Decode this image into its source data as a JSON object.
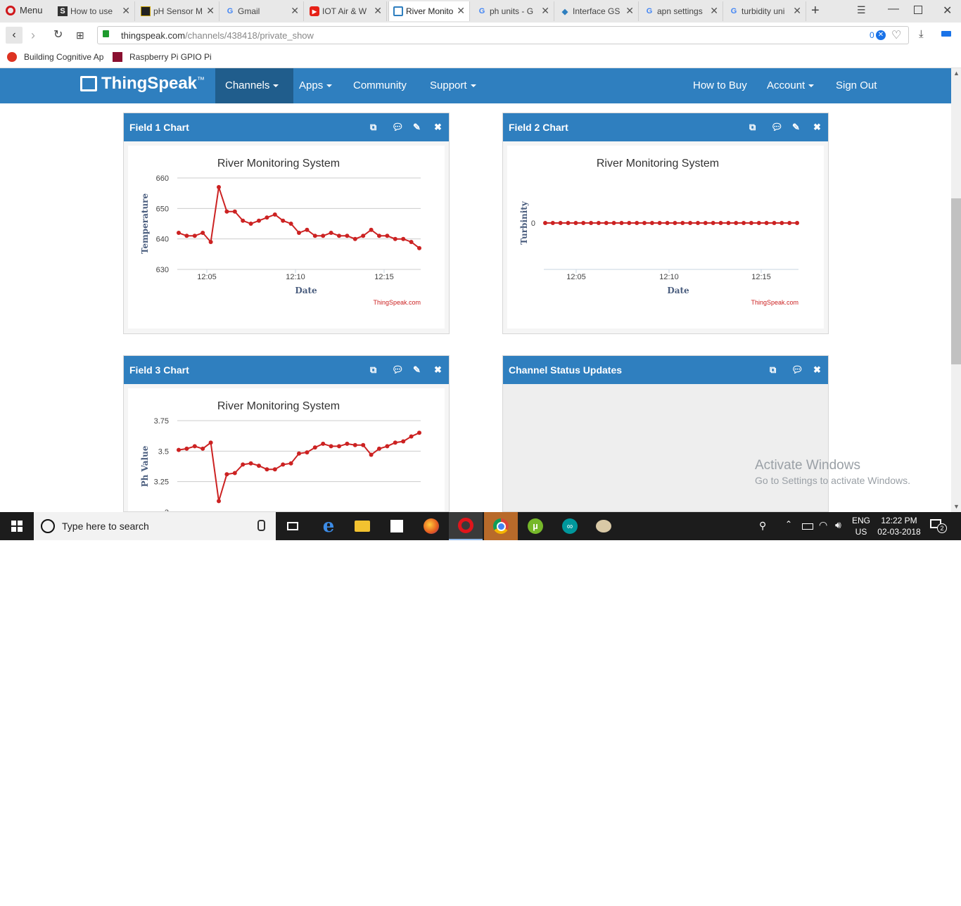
{
  "browser": {
    "menu_label": "Menu",
    "tabs": [
      {
        "label": "How to use",
        "icon": "s-favicon"
      },
      {
        "label": "pH Sensor M",
        "icon": "sensor-favicon"
      },
      {
        "label": "Gmail",
        "icon": "google-favicon"
      },
      {
        "label": "IOT Air & W",
        "icon": "youtube-favicon"
      },
      {
        "label": "River Monito",
        "icon": "thingspeak-favicon"
      },
      {
        "label": "ph units - G",
        "icon": "google-favicon"
      },
      {
        "label": "Interface GS",
        "icon": "diamond-favicon"
      },
      {
        "label": "apn settings",
        "icon": "google-favicon"
      },
      {
        "label": "turbidity uni",
        "icon": "google-favicon"
      }
    ],
    "url_domain": "thingspeak.com",
    "url_path": "/channels/438418/private_show",
    "adblock_count": "0",
    "bookmarks": [
      {
        "label": "Building Cognitive Ap"
      },
      {
        "label": "Raspberry Pi GPIO Pi"
      }
    ]
  },
  "site": {
    "logo": "ThingSpeak",
    "logo_tm": "™",
    "nav": {
      "channels": "Channels",
      "apps": "Apps",
      "community": "Community",
      "support": "Support",
      "how_to_buy": "How to Buy",
      "account": "Account",
      "sign_out": "Sign Out"
    }
  },
  "panels": {
    "field1": {
      "title": "Field 1 Chart"
    },
    "field2": {
      "title": "Field 2 Chart"
    },
    "field3": {
      "title": "Field 3 Chart"
    },
    "status": {
      "title": "Channel Status Updates"
    }
  },
  "chart_data": [
    {
      "type": "line",
      "title": "River Monitoring System",
      "xlabel": "Date",
      "ylabel": "Temperature",
      "credit": "ThingSpeak.com",
      "x_ticks": [
        "12:05",
        "12:10",
        "12:15"
      ],
      "y_ticks": [
        630,
        640,
        650,
        660
      ],
      "ylim": [
        630,
        660
      ],
      "color": "#cc2222",
      "values": [
        642,
        641,
        641,
        642,
        639,
        657,
        649,
        649,
        646,
        645,
        646,
        647,
        648,
        646,
        645,
        642,
        643,
        641,
        641,
        642,
        641,
        641,
        640,
        641,
        643,
        641,
        641,
        640,
        640,
        639,
        637
      ]
    },
    {
      "type": "line",
      "title": "River Monitoring System",
      "xlabel": "Date",
      "ylabel": "Turbinity",
      "credit": "ThingSpeak.com",
      "x_ticks": [
        "12:05",
        "12:10",
        "12:15"
      ],
      "y_ticks": [
        0
      ],
      "color": "#cc2222",
      "values": [
        0,
        0,
        0,
        0,
        0,
        0,
        0,
        0,
        0,
        0,
        0,
        0,
        0,
        0,
        0,
        0,
        0,
        0,
        0,
        0,
        0,
        0,
        0,
        0,
        0,
        0,
        0,
        0,
        0,
        0,
        0,
        0,
        0,
        0
      ]
    },
    {
      "type": "line",
      "title": "River Monitoring System",
      "ylabel": "Ph Value",
      "y_ticks": [
        "3",
        "3.25",
        "3.5",
        "3.75"
      ],
      "ylim": [
        3,
        3.75
      ],
      "color": "#cc2222",
      "values": [
        3.51,
        3.52,
        3.54,
        3.52,
        3.57,
        3.09,
        3.31,
        3.32,
        3.39,
        3.4,
        3.38,
        3.35,
        3.35,
        3.39,
        3.4,
        3.48,
        3.49,
        3.53,
        3.56,
        3.54,
        3.54,
        3.56,
        3.55,
        3.55,
        3.47,
        3.52,
        3.54,
        3.57,
        3.58,
        3.62,
        3.65
      ]
    }
  ],
  "watermark": {
    "line1": "Activate Windows",
    "line2": "Go to Settings to activate Windows."
  },
  "taskbar": {
    "search_placeholder": "Type here to search",
    "lang": "ENG",
    "region": "US",
    "time": "12:22 PM",
    "date": "02-03-2018",
    "notification_count": "2"
  }
}
